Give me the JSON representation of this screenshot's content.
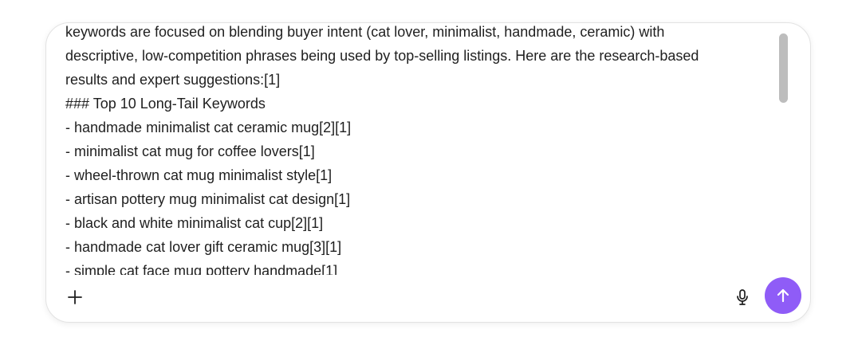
{
  "composer": {
    "lines": [
      "keywords are focused on blending buyer intent (cat lover, minimalist, handmade, ceramic) with",
      "descriptive, low-competition phrases being used by top-selling listings. Here are the research-based",
      "results and expert suggestions:[1]",
      "### Top 10 Long-Tail Keywords",
      "- handmade minimalist cat ceramic mug[2][1]",
      "- minimalist cat mug for coffee lovers[1]",
      "- wheel-thrown cat mug minimalist style[1]",
      "- artisan pottery mug minimalist cat design[1]",
      "- black and white minimalist cat cup[2][1]",
      "- handmade cat lover gift ceramic mug[3][1]",
      "- simple cat face mug pottery handmade[1]"
    ]
  },
  "toolbar": {
    "add_icon": "plus-icon",
    "mic_icon": "microphone-icon",
    "send_icon": "arrow-up-icon"
  },
  "colors": {
    "send_button": "#8f5cf7",
    "text": "#1f1f1f",
    "border": "#e3e3e3",
    "scrollbar": "#bdbdbd"
  }
}
